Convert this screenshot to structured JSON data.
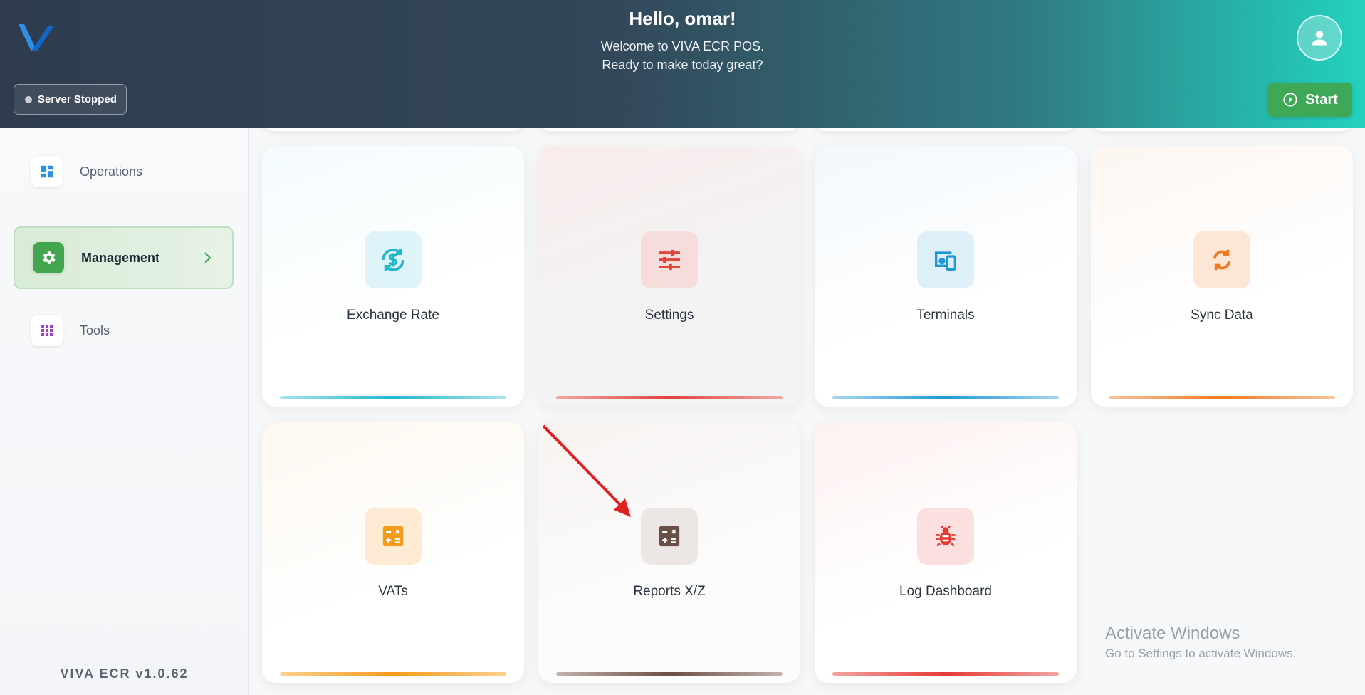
{
  "header": {
    "greeting": "Hello, omar!",
    "welcome": "Welcome to VIVA ECR POS.",
    "tagline": "Ready to make today great?",
    "server_status": "Server Stopped",
    "start_label": "Start"
  },
  "sidebar": {
    "items": [
      {
        "label": "Operations",
        "icon": "dashboard-icon"
      },
      {
        "label": "Management",
        "icon": "gear-icon"
      },
      {
        "label": "Tools",
        "icon": "apps-grid-icon"
      }
    ],
    "version": "VIVA ECR  v1.0.62"
  },
  "cards": [
    {
      "label": "Exchange Rate",
      "icon": "currency-exchange-icon",
      "color": "#1fb8cc"
    },
    {
      "label": "Settings",
      "icon": "sliders-icon",
      "color": "#e0443a"
    },
    {
      "label": "Terminals",
      "icon": "devices-icon",
      "color": "#1e98d8"
    },
    {
      "label": "Sync Data",
      "icon": "sync-icon",
      "color": "#ef7a22"
    },
    {
      "label": "VATs",
      "icon": "calculator-icon",
      "color": "#f59b1a"
    },
    {
      "label": "Reports X/Z",
      "icon": "calculator-icon",
      "color": "#6b4e45"
    },
    {
      "label": "Log Dashboard",
      "icon": "bug-icon",
      "color": "#e53935"
    }
  ],
  "watermark": {
    "title": "Activate Windows",
    "subtitle": "Go to Settings to activate Windows."
  }
}
